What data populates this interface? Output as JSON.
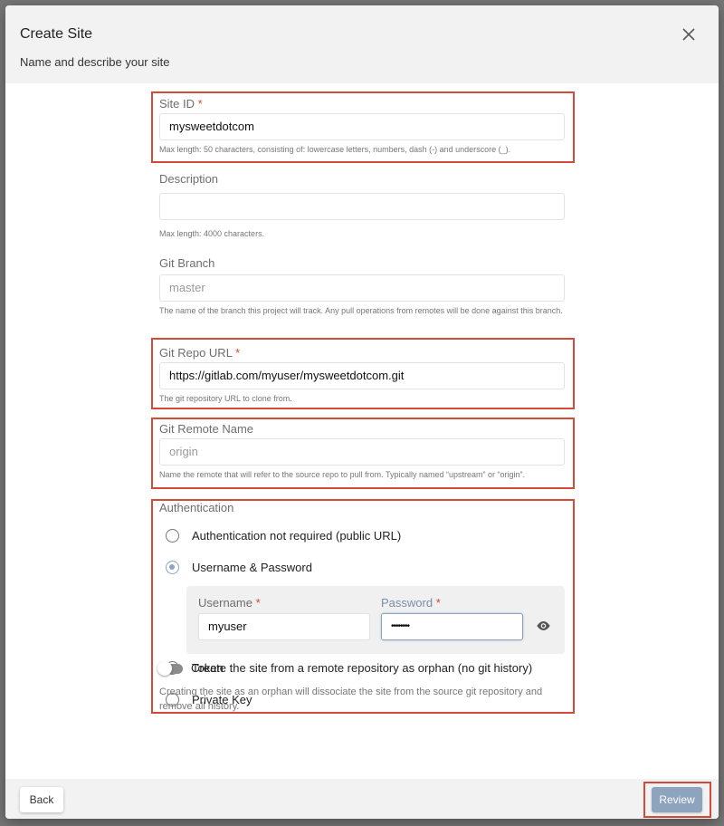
{
  "dialog": {
    "title": "Create Site",
    "subtitle": "Name and describe your site",
    "close_icon": "close-icon"
  },
  "form": {
    "site_id": {
      "label": "Site ID",
      "required_mark": "*",
      "value": "mysweetdotcom",
      "help": "Max length: 50 characters, consisting of: lowercase letters, numbers, dash (-) and underscore (_)."
    },
    "description": {
      "label": "Description",
      "value": "",
      "help": "Max length: 4000 characters."
    },
    "git_branch": {
      "label": "Git Branch",
      "placeholder": "master",
      "help": "The name of the branch this project will track. Any pull operations from remotes will be done against this branch."
    },
    "git_repo_url": {
      "label": "Git Repo URL",
      "required_mark": "*",
      "value": "https://gitlab.com/myuser/mysweetdotcom.git",
      "help": "The git repository URL to clone from."
    },
    "git_remote_name": {
      "label": "Git Remote Name",
      "placeholder": "origin",
      "help": "Name the remote that will refer to the source repo to pull from. Typically named “upstream” or “origin”."
    },
    "authentication": {
      "label": "Authentication",
      "options": [
        {
          "label": "Authentication not required (public URL)",
          "selected": false
        },
        {
          "label": "Username & Password",
          "selected": true
        },
        {
          "label": "Token",
          "selected": false
        },
        {
          "label": "Private Key",
          "selected": false
        }
      ],
      "username": {
        "label": "Username",
        "required_mark": "*",
        "value": "myuser"
      },
      "password": {
        "label": "Password",
        "required_mark": "*",
        "value": "••••••••"
      },
      "show_password_icon": "eye-icon"
    },
    "orphan": {
      "label": "Create the site from a remote repository as orphan (no git history)",
      "enabled": false,
      "help": "Creating the site as an orphan will dissociate the site from the source git repository and remove all history."
    }
  },
  "footer": {
    "back_label": "Back",
    "review_label": "Review"
  },
  "colors": {
    "highlight": "#d24a38",
    "accent": "#8ea3bd",
    "required": "#d24a38"
  }
}
